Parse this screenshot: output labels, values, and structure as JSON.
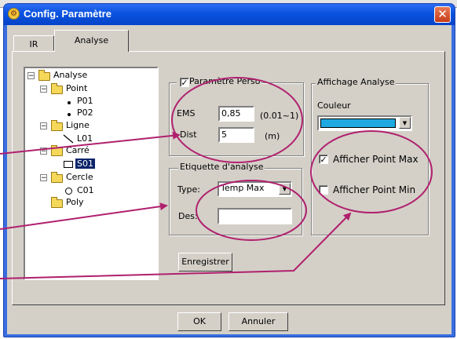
{
  "window": {
    "title": "Config. Paramètre",
    "close_glyph": "✕",
    "app_icon": "⚙"
  },
  "tabs": [
    {
      "label": "IR"
    },
    {
      "label": "Analyse"
    }
  ],
  "tree": {
    "root": "Analyse",
    "point": "Point",
    "p01": "P01",
    "p02": "P02",
    "ligne": "Ligne",
    "l01": "L01",
    "carre": "Carré",
    "s01": "S01",
    "cercle": "Cercle",
    "c01": "C01",
    "poly": "Poly",
    "minus": "−"
  },
  "perso": {
    "checkbox_label": "Paramètre Perso",
    "checked_glyph": "✓",
    "ems_label": "EMS",
    "ems_value": "0,85",
    "ems_range": "(0.01~1)",
    "dist_label": "Dist",
    "dist_value": "5",
    "dist_unit": "(m)"
  },
  "etiquette": {
    "title": "Etiquette d'analyse",
    "type_label": "Type:",
    "type_value": "Temp Max",
    "des_label": "Des:",
    "des_value": ""
  },
  "affichage": {
    "title": "Affichage Analyse",
    "couleur_label": "Couleur",
    "couleur_hex": "#1fa9e0",
    "max_label": "Afficher Point Max",
    "max_checked": "✓",
    "min_label": "Afficher Point Min",
    "min_checked": ""
  },
  "buttons": {
    "enregistrer": "Enregistrer",
    "ok": "OK",
    "annuler": "Annuler"
  },
  "annotation_color": "#b0206e"
}
